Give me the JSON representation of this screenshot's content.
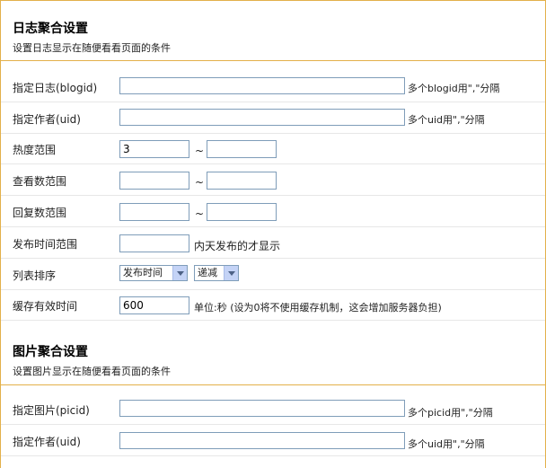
{
  "blog_section": {
    "title": "日志聚合设置",
    "desc": "设置日志显示在随便看看页面的条件",
    "rows": {
      "blogid": {
        "label": "指定日志(blogid)",
        "value": "",
        "hint": "多个blogid用\",\"分隔"
      },
      "uid": {
        "label": "指定作者(uid)",
        "value": "",
        "hint": "多个uid用\",\"分隔"
      },
      "hot": {
        "label": "热度范围",
        "min": "3",
        "max": "",
        "sep": "~"
      },
      "view": {
        "label": "查看数范围",
        "min": "",
        "max": "",
        "sep": "~"
      },
      "reply": {
        "label": "回复数范围",
        "min": "",
        "max": "",
        "sep": "~"
      },
      "dateline": {
        "label": "发布时间范围",
        "value": "",
        "hint": "内天发布的才显示"
      },
      "order": {
        "label": "列表排序",
        "orderby": "发布时间",
        "direction": "递减"
      },
      "cache": {
        "label": "缓存有效时间",
        "value": "600",
        "hint": "单位:秒 (设为0将不使用缓存机制，这会增加服务器负担)"
      }
    }
  },
  "pic_section": {
    "title": "图片聚合设置",
    "desc": "设置图片显示在随便看看页面的条件",
    "rows": {
      "picid": {
        "label": "指定图片(picid)",
        "value": "",
        "hint": "多个picid用\",\"分隔"
      },
      "uid": {
        "label": "指定作者(uid)",
        "value": "",
        "hint": "多个uid用\",\"分隔"
      }
    }
  }
}
